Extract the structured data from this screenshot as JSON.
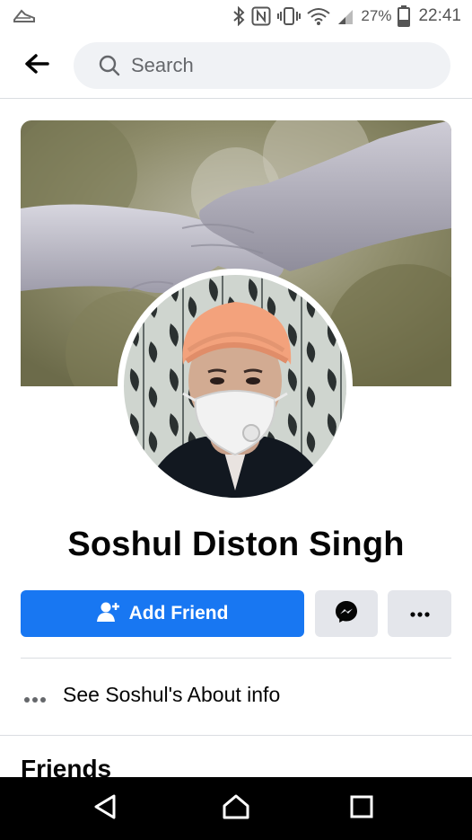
{
  "status_bar": {
    "battery": "27%",
    "time": "22:41"
  },
  "header": {
    "search_placeholder": "Search"
  },
  "profile": {
    "name": "Soshul Diston Singh"
  },
  "actions": {
    "add_friend_label": "Add Friend"
  },
  "about": {
    "label": "See Soshul's About info"
  },
  "sections": {
    "friends_title": "Friends"
  },
  "colors": {
    "accent": "#1877f2",
    "secondary_button": "#e4e6eb",
    "search_bg": "#f0f2f5",
    "text": "#050505",
    "muted": "#65676b"
  },
  "icons": {
    "status_left": "app-notification-icon",
    "bluetooth": "bluetooth-icon",
    "nfc": "nfc-icon",
    "vibrate": "vibrate-icon",
    "wifi": "wifi-icon",
    "signal": "signal-icon",
    "battery": "battery-icon",
    "back": "back-arrow-icon",
    "search": "search-icon",
    "add_friend": "add-person-icon",
    "messenger": "messenger-icon",
    "more": "more-dots-icon",
    "about": "more-dots-icon",
    "nav_back": "nav-back-icon",
    "nav_home": "nav-home-icon",
    "nav_recents": "nav-recents-icon"
  }
}
